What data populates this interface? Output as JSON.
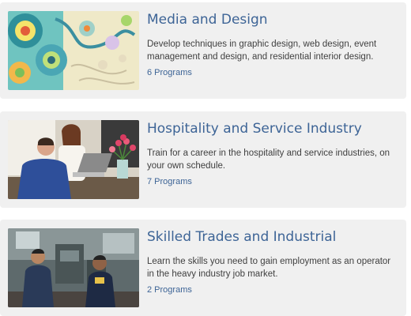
{
  "programs": [
    {
      "title": "Media and Design",
      "description": "Develop techniques in graphic design, web design, event management and design, and residential interior design.",
      "link": "6 Programs",
      "image": "colorful-paisley-pattern-image"
    },
    {
      "title": "Hospitality and Service Industry",
      "description": "Train for a career in the hospitality and service industries, on your own schedule.",
      "link": "7 Programs",
      "image": "people-at-laptop-with-tulips-image"
    },
    {
      "title": "Skilled Trades and Industrial",
      "description": "Learn the skills you need to gain employment as an operator in the heavy industry job market.",
      "link": "2 Programs",
      "image": "workers-in-machine-shop-image"
    }
  ],
  "colors": {
    "card_background": "#f0f0f0",
    "title": "#3d6496",
    "link": "#3d6496",
    "body_text": "#404040"
  }
}
